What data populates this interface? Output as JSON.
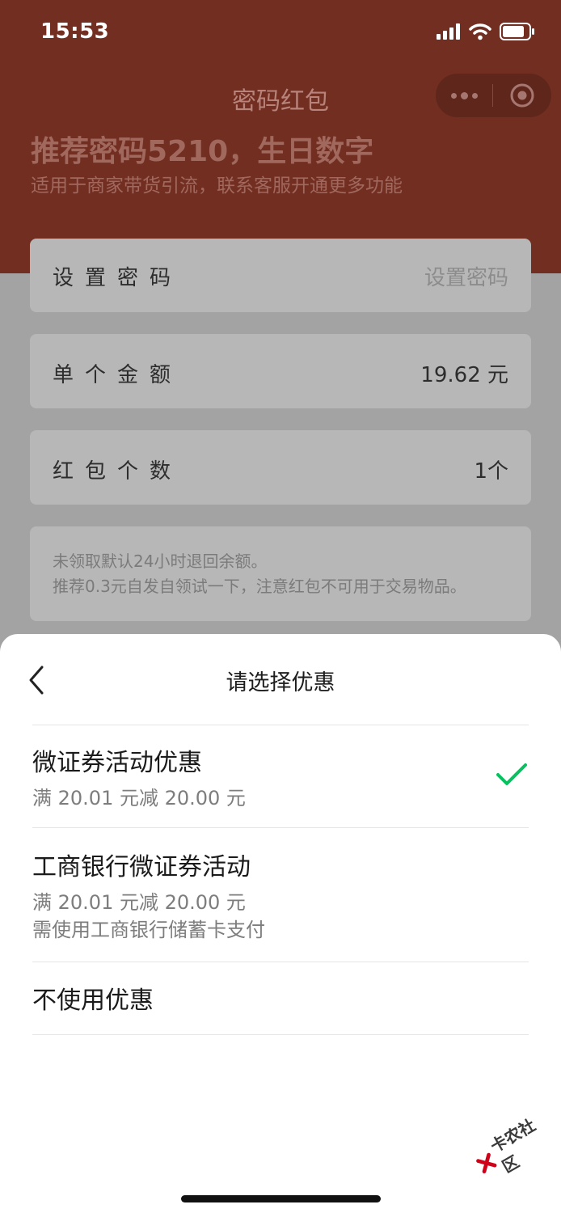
{
  "status_bar": {
    "time": "15:53"
  },
  "nav": {
    "title": "密码红包"
  },
  "hero": {
    "title": "推荐密码5210，生日数字",
    "subtitle": "适用于商家带货引流，联系客服开通更多功能"
  },
  "form": {
    "password": {
      "label": "设置密码",
      "placeholder": "设置密码"
    },
    "amount": {
      "label": "单个金额",
      "value": "19.62 元"
    },
    "count": {
      "label": "红包个数",
      "value": "1个"
    },
    "notice": [
      "未领取默认24小时退回余额。",
      "推荐0.3元自发自领试一下，注意红包不可用于交易物品。"
    ]
  },
  "sheet": {
    "title": "请选择优惠",
    "options": [
      {
        "title": "微证券活动优惠",
        "desc": [
          "满 20.01 元减 20.00 元"
        ],
        "selected": true
      },
      {
        "title": "工商银行微证券活动",
        "desc": [
          "满 20.01 元减 20.00 元",
          "需使用工商银行储蓄卡支付"
        ],
        "selected": false
      },
      {
        "title": "不使用优惠",
        "desc": [],
        "selected": false
      }
    ]
  },
  "watermark": "卡农社区",
  "colors": {
    "header_bg": "#712e21",
    "check": "#07c160",
    "dim_bg": "#a3a3a3"
  },
  "icons": [
    "signal-icon",
    "wifi-icon",
    "battery-icon",
    "more-icon",
    "target-icon",
    "back-icon",
    "check-icon"
  ]
}
